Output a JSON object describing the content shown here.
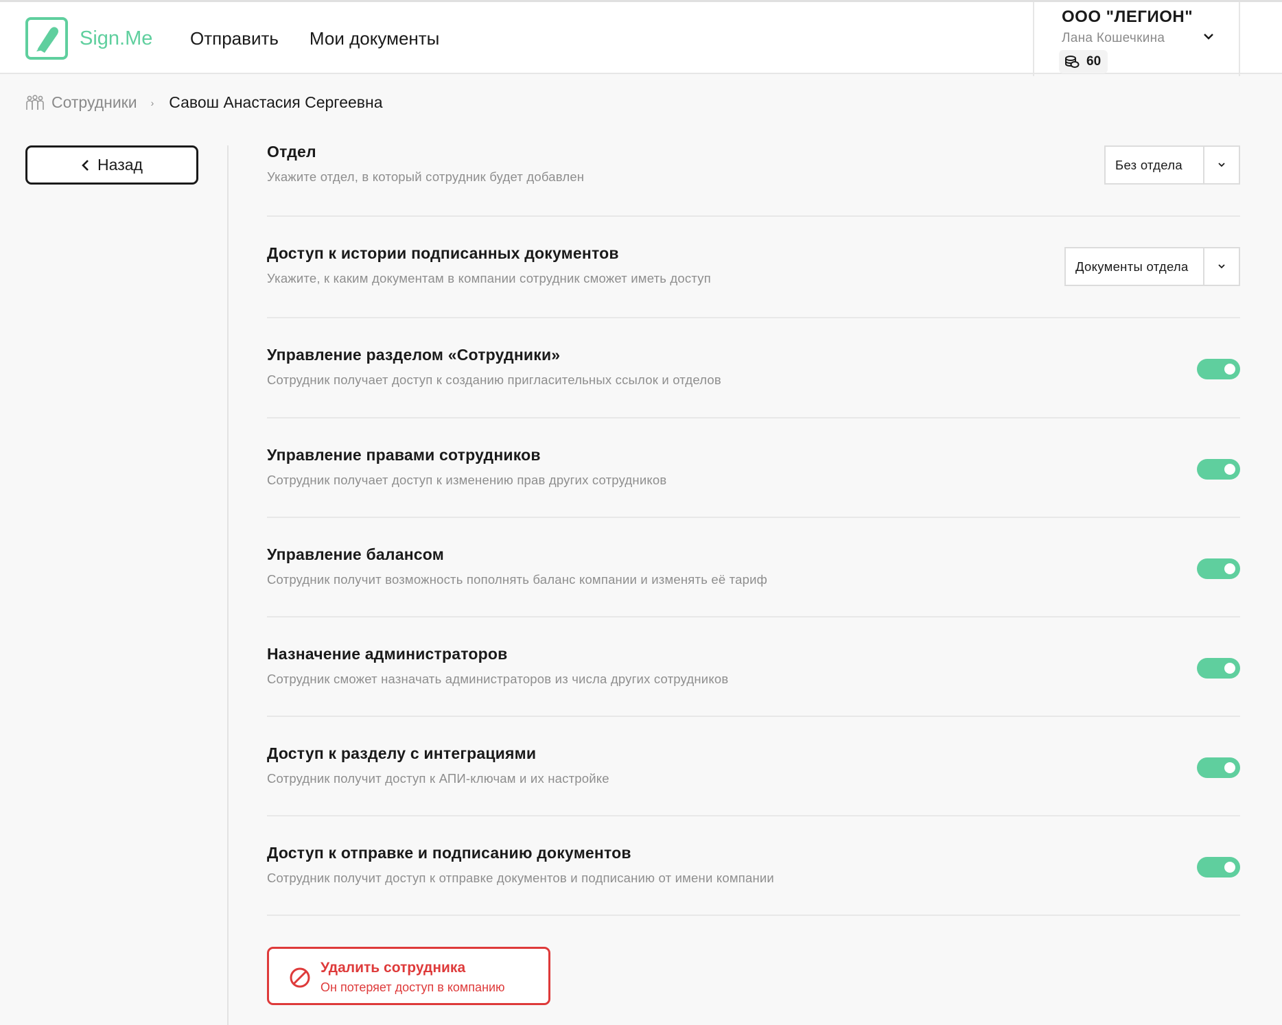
{
  "app": {
    "name": "Sign.Me",
    "brand_color": "#5fcf9e",
    "danger_color": "#de3a3a"
  },
  "nav": {
    "send": "Отправить",
    "my_docs": "Мои документы"
  },
  "account": {
    "company": "ООО \"ЛЕГИОН\"",
    "user": "Лана Кошечкина",
    "balance": "60"
  },
  "breadcrumb": {
    "parent": "Сотрудники",
    "current": "Савош Анастасия Сергеевна"
  },
  "back_label": "Назад",
  "settings": [
    {
      "title": "Отдел",
      "desc": "Укажите отдел, в который сотрудник будет добавлен",
      "control": "select",
      "value": "Без отдела"
    },
    {
      "title": "Доступ к истории подписанных документов",
      "desc": "Укажите, к каким документам в компании сотрудник сможет иметь доступ",
      "control": "select",
      "value": "Документы отдела"
    },
    {
      "title": "Управление разделом «Сотрудники»",
      "desc": "Сотрудник получает доступ к созданию пригласительных ссылок и отделов",
      "control": "toggle",
      "value": "on"
    },
    {
      "title": "Управление правами сотрудников",
      "desc": "Сотрудник получает доступ к изменению прав других сотрудников",
      "control": "toggle",
      "value": "on"
    },
    {
      "title": "Управление балансом",
      "desc": "Сотрудник получит возможность пополнять баланс компании и изменять её тариф",
      "control": "toggle",
      "value": "on"
    },
    {
      "title": "Назначение администраторов",
      "desc": "Сотрудник сможет назначать администраторов из числа других сотрудников",
      "control": "toggle",
      "value": "on"
    },
    {
      "title": "Доступ к разделу с интеграциями",
      "desc": "Сотрудник получит доступ к АПИ-ключам и их настройке",
      "control": "toggle",
      "value": "on"
    },
    {
      "title": "Доступ к отправке и подписанию документов",
      "desc": "Сотрудник получит доступ к отправке документов и подписанию от имени компании",
      "control": "toggle",
      "value": "on"
    }
  ],
  "delete": {
    "title": "Удалить сотрудника",
    "subtitle": "Он потеряет доступ в компанию"
  }
}
